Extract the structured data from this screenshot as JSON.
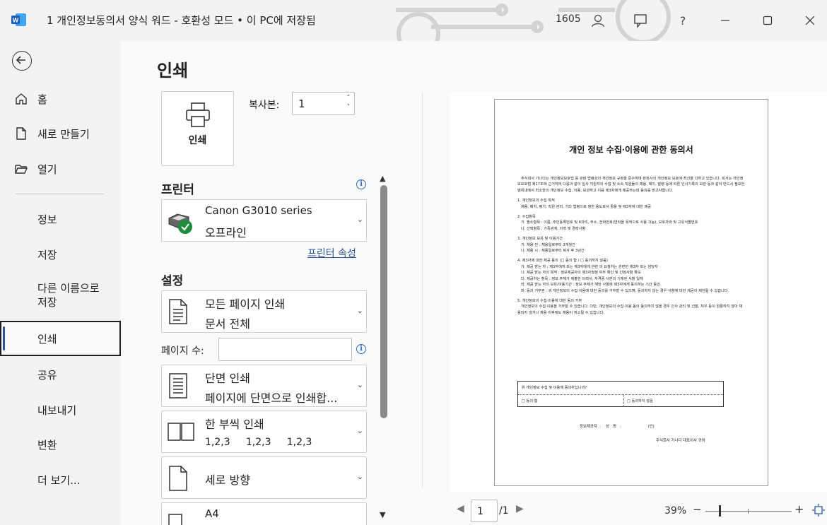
{
  "titlebar": {
    "app_letter": "W",
    "title": "1 개인정보동의서 양식 워드  -  호환성 모드 • 이 PC에 저장됨",
    "user_id": "1605",
    "help_label": "?"
  },
  "nav": {
    "home": "홈",
    "new": "새로 만들기",
    "open": "열기",
    "info": "정보",
    "save": "저장",
    "save_as_line1": "다른 이름으로",
    "save_as_line2": "저장",
    "print": "인쇄",
    "share": "공유",
    "export": "내보내기",
    "transform": "변환",
    "more": "더 보기..."
  },
  "print": {
    "page_title": "인쇄",
    "print_button": "인쇄",
    "copies_label": "복사본:",
    "copies_value": "1"
  },
  "printer": {
    "heading": "프린터",
    "name": "Canon G3010 series",
    "status": "오프라인",
    "properties_link": "프린터 속성"
  },
  "settings": {
    "heading": "설정",
    "pages_option_title": "모든 페이지 인쇄",
    "pages_option_sub": "문서 전체",
    "pages_label": "페이지 수:",
    "pages_value": "",
    "sides_title": "단면 인쇄",
    "sides_sub": "페이지에 단면으로 인쇄합...",
    "collate_title": "한 부씩 인쇄",
    "collate_sub": "1,2,3     1,2,3     1,2,3",
    "orientation_title": "세로 방향",
    "paper_title": "A4"
  },
  "preview_doc": {
    "title": "개인 정보 수집·이용에 관한 동의서",
    "intro": "   주식회사 가나다는 개인정보보호법 등 관련 법령상의 개인정보 규정을 준수하며 본회사의 개인정보 보호에 최선을 다하고 있습니다. 회사는 개인정보보호법 제17조에 근거하여 다음과 같이 입사 지원자의 수집 및 소속 직원들의 채용, 해지, 발령 등에 따른 인사기록의 보관 등과 같이 반드시 필요한 범위내에서 최소한의 개인정보 수집, 이용, 보관하고 이를 제3자에게 제공하는데 동의를 받고자합니다.",
    "s1_h": "1. 개인정보의 수집 목적",
    "s1_a": "   채용, 배치, 평가, 직원 관리, 기타 법령으로 정한 용도로서 활용 및 제3자에 대한 제공",
    "s2_h": "2. 수집항목",
    "s2_a": "   가. 필수항목 : 이름, 주민등록번호 및 6자리, 주소, 전화번호(연락을 목적으로 사용 가능), 보호자와 및 고유식별번호",
    "s2_b": "   나. 선택항목 : 가족관계, 이력 및 경력사항",
    "s3_h": "3. 개인정보 보유 및 이용기간",
    "s3_a": "   가. 채용 전 : 채용일로부터 3개월간",
    "s3_b": "   나. 채용 시 : 채용일로부터 퇴사 후 3년간",
    "s4_h": "4. 제3자에 대한 제공 동의 (□ 동의 함 / □ 동의하지 않음)",
    "s4_a": "   가. 제공 받는 자 : 제3자에게 또는 제3자에게 관련 의 요청하는 관련한 제3자 또는 담당자",
    "s4_b": "   나. 제공 받는 자의 목적 : 정보제공자의 제3자정정 여부 확인 및 인정사항 확보",
    "s4_c": "   다. 제공하는 항목 : 정보 주체가 제출한 이력서, 자격증 사본의 기재된 사항 일체",
    "s4_d": "   라. 제공 받는 자의 보유/이용기간 : 정보 주체가 해당 사항에 제3자에게 동의하는 기간 동안",
    "s4_e": "   마. 동의 거부권 : 귀 개인정보의 수집·이용에 대한 동의를 거부할 수 있으며, 동의하지 않는 경우 사항에 대한 제공이 제한될 수 있습니다.",
    "s5_h": "5. 개인정보의 수집·이용에 대한 동의 거부",
    "s5_a": "   개인정보의 수집·이용을 거부할 수 있습니다. 다만, 개인정보의 수집·이용 동의 동의하지 않을 경우 인사 관리 및 선발, 처우 등이 원활하지 않아 채용되지 않거나 채용 이후에도 채용이 취소될 수 있습니다.",
    "table_question": "위 개인정보 수집 및 이용에 동의하십니까?",
    "agree": "□ 동의 함",
    "disagree": "□ 동의하지 않음",
    "signature": "정보제공자  :    성   명   :                      (인)",
    "company": "주식회사 가나다 대표이사 귀하"
  },
  "preview_nav": {
    "current_page": "1",
    "total_pages": "/1",
    "zoom": "39%",
    "zoom_level": 0.39
  }
}
